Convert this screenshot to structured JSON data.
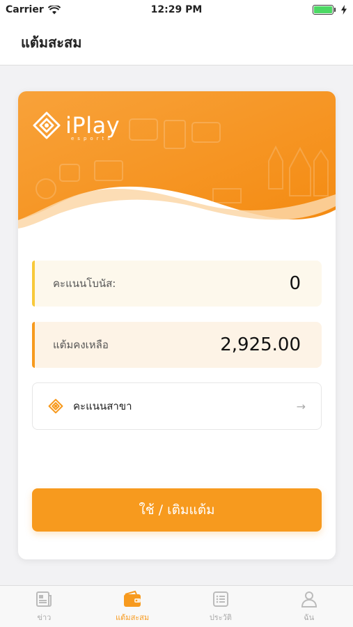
{
  "status_bar": {
    "carrier": "Carrier",
    "time": "12:29 PM"
  },
  "header": {
    "title": "แต้มสะสม"
  },
  "brand": {
    "name": "iPlay",
    "tagline": "esports",
    "accent": "#f79a1e"
  },
  "balances": {
    "bonus_label": "คะแนนโบนัส:",
    "bonus_value": "0",
    "points_label": "แต้มคงเหลือ",
    "points_value": "2,925.00"
  },
  "branch": {
    "label": "คะแนนสาขา"
  },
  "cta": {
    "label": "ใช้ / เติมแต้ม"
  },
  "tabs": [
    {
      "label": "ข่าว",
      "icon": "news-icon"
    },
    {
      "label": "แต้มสะสม",
      "icon": "wallet-icon",
      "active": true
    },
    {
      "label": "ประวัติ",
      "icon": "history-list-icon"
    },
    {
      "label": "ฉัน",
      "icon": "profile-icon"
    }
  ]
}
